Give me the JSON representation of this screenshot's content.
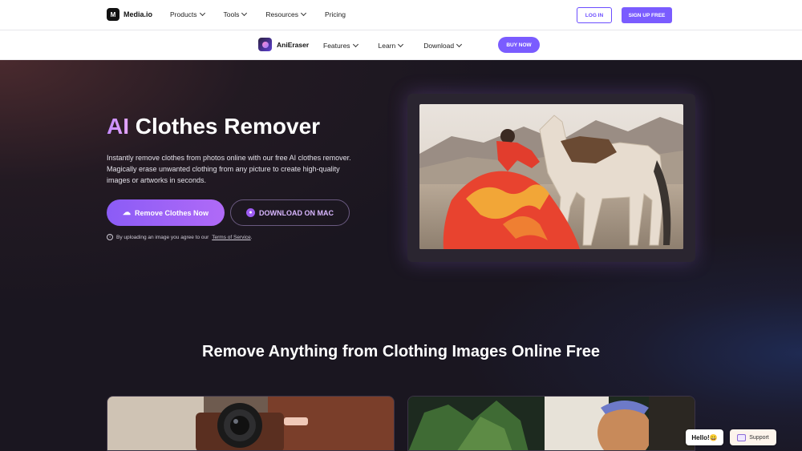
{
  "topnav": {
    "logo_text": "Media.io",
    "menu": [
      {
        "label": "Products"
      },
      {
        "label": "Tools"
      },
      {
        "label": "Resources"
      },
      {
        "label": "Pricing"
      }
    ],
    "login_label": "LOG IN",
    "signup_label": "SIGN UP FREE"
  },
  "subnav": {
    "app_name": "AniEraser",
    "menu": [
      {
        "label": "Features"
      },
      {
        "label": "Learn"
      },
      {
        "label": "Download"
      }
    ],
    "buy_label": "BUY NOW"
  },
  "hero": {
    "title_accent": "AI",
    "title_rest": "Clothes Remover",
    "description": "Instantly remove clothes from photos online with our free AI clothes remover. Magically erase unwanted clothing from any picture to create high-quality images or artworks in seconds.",
    "primary_button": "Remove Clothes Now",
    "secondary_button": "DOWNLOAD ON MAC",
    "terms_prefix": "By uploading an image you agree to our",
    "terms_link": "Terms of Service",
    "terms_suffix": "."
  },
  "section": {
    "title": "Remove Anything from Clothing Images Online Free"
  },
  "widgets": {
    "hello": "Hello!😀",
    "support": "Support"
  },
  "colors": {
    "accent": "#7a5cff",
    "hero_bg": "#1a1620",
    "title_gradient_start": "#c48aff"
  }
}
